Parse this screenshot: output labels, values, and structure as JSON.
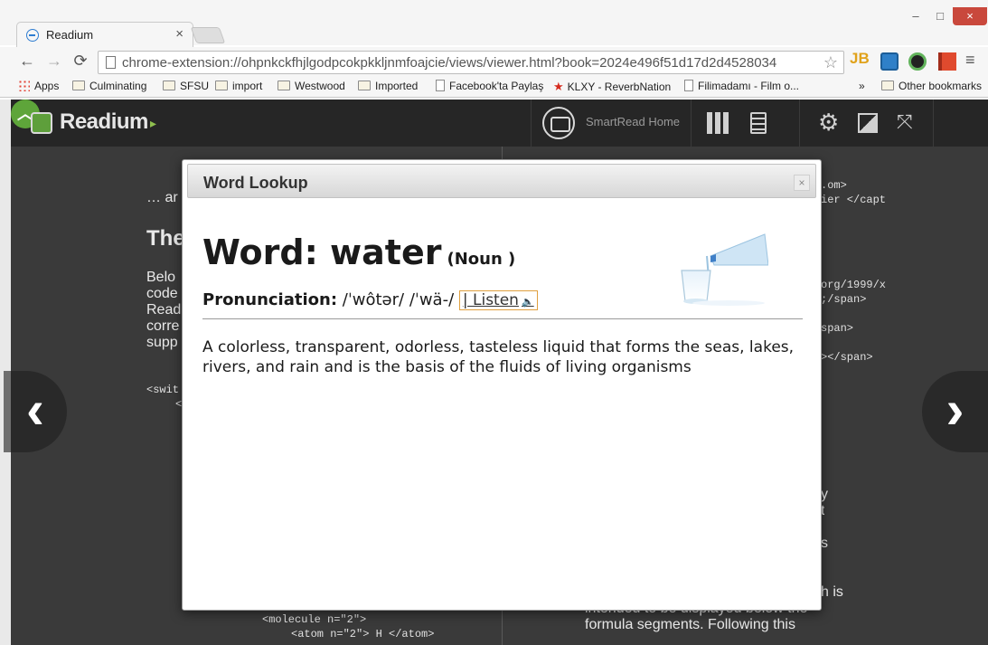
{
  "browser": {
    "tab_title": "Readium",
    "tab_close": "×",
    "window_controls": {
      "minimize": "–",
      "maximize": "□",
      "close": "×"
    },
    "url": "chrome-extension://ohpnkckfhjlgodpcokpkkljnmfoajcie/views/viewer.html?book=2024e496f51d17d2d4528034",
    "extensions": {
      "jb": "JB"
    },
    "bookmarks": [
      {
        "label": "Apps",
        "icon": "apps-icon"
      },
      {
        "label": "Culminating",
        "icon": "folder-icon"
      },
      {
        "label": "SFSU",
        "icon": "folder-icon"
      },
      {
        "label": "import",
        "icon": "folder-icon"
      },
      {
        "label": "Westwood",
        "icon": "folder-icon"
      },
      {
        "label": "Imported",
        "icon": "folder-icon"
      },
      {
        "label": "Facebook'ta Paylaş",
        "icon": "page-icon"
      },
      {
        "label": "KLXY - ReverbNation",
        "icon": "star-icon"
      },
      {
        "label": "Filimadamı - Film o...",
        "icon": "page-icon"
      }
    ],
    "bookmarks_overflow": "»",
    "other_bookmarks": "Other bookmarks"
  },
  "reader": {
    "logo": "Readium",
    "smartread_label": "SmartRead Home",
    "colors": {
      "bar": "#262626",
      "accent_green": "#5ea53a"
    }
  },
  "background_text": {
    "left_lines": [
      "… ar",
      "The",
      "Belo",
      "code",
      "Read",
      "corre",
      "supp",
      "<swit",
      "<"
    ],
    "left_bottom": [
      "<molecule n=\"2\">",
      "<atom n=\"2\"> H </atom>"
    ],
    "right_code": [
      ".om>",
      "ier </capt",
      "org/1999/x",
      ";/span>",
      "span>",
      "></span>"
    ],
    "right_prose": [
      "y",
      "t",
      "s",
      "h is",
      "intended to be displayed below the",
      "formula segments. Following this"
    ]
  },
  "dialog": {
    "title": "Word Lookup",
    "close": "×",
    "word_prefix": "Word: ",
    "word": "water",
    "part_of_speech": "(Noun )",
    "pron_label": "Pronunciation:",
    "pron_text": " /ˈwôtər/ /ˈwä-/ ",
    "listen_label": "| Listen",
    "definition": "A colorless, transparent, odorless, tasteless liquid that forms the seas, lakes, rivers, and rain and is the basis of the fluids of living organisms"
  }
}
